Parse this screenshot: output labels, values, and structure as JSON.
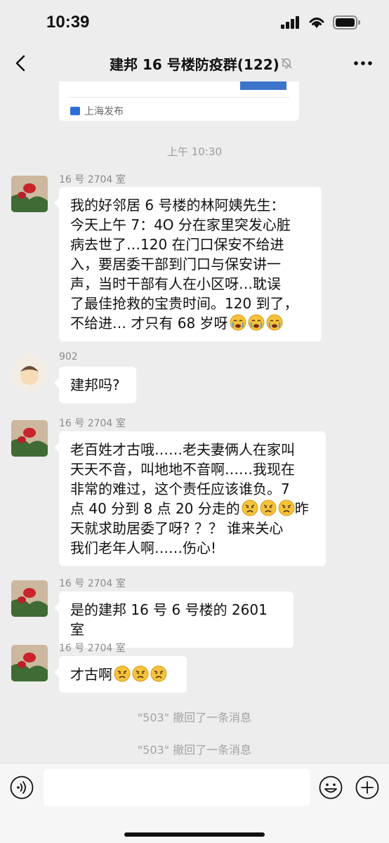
{
  "status_bar": {
    "time": "10:39"
  },
  "nav": {
    "title": "建邦 16 号楼防疫群(122)"
  },
  "share_card": {
    "source": "上海发布"
  },
  "timestamp": "上午 10:30",
  "messages": [
    {
      "sender": "16 号 2704 室",
      "lines": [
        "我的好邻居 6 号楼的林阿姨先生：",
        "今天上午 7：4O 分在家里突发心脏",
        "病去世了…120 在门口保安不给进",
        "入，要居委干部到门口与保安讲一",
        "声，当时干部有人在小区呀…耽误",
        "了最佳抢救的宝贵时间。120 到了，",
        "不给进… 才只有 68 岁呀"
      ]
    },
    {
      "sender": "902",
      "lines": [
        "建邦吗?"
      ]
    },
    {
      "sender": "16 号 2704 室",
      "lines": [
        "老百姓才古哦……老夫妻俩人在家叫",
        "天天不音，叫地地不音啊……我现在",
        "非常的难过，这个责任应该谁负。7",
        "点 40 分到 8 点 20 分走的",
        "天就求助居委了呀? ？？ 谁来关心",
        "我们老年人啊……伤心!"
      ],
      "line4_tail": "昨"
    },
    {
      "sender": "16 号 2704 室",
      "lines": [
        "是的建邦 16 号 6 号楼的 2601 室"
      ]
    },
    {
      "sender": "16 号 2704 室",
      "lines": [
        "才古啊"
      ]
    }
  ],
  "recall_notices": [
    "\"503\" 撤回了一条消息",
    "\"503\" 撤回了一条消息"
  ],
  "input": {
    "placeholder": ""
  },
  "icons": {
    "back": "chevron-left-icon",
    "mute": "bell-off-icon",
    "more": "ellipsis-icon",
    "voice": "voice-icon",
    "emoji": "smiley-icon",
    "plus": "plus-icon",
    "cry": "crying-emoji",
    "angry": "angry-emoji"
  }
}
